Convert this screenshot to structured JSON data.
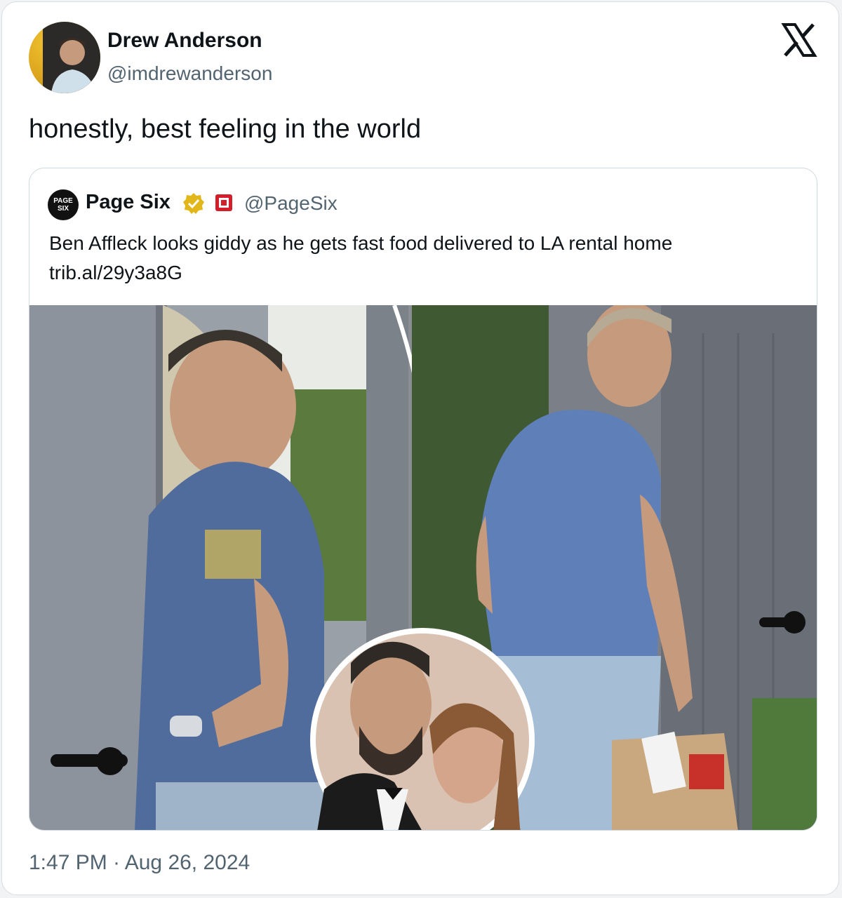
{
  "tweet": {
    "author_name": "Drew Anderson",
    "author_handle": "@imdrewanderson",
    "text": "honestly, best feeling in the world",
    "timestamp": "1:47 PM · Aug 26, 2024"
  },
  "quoted_tweet": {
    "author_name": "Page Six",
    "author_handle": "@PageSix",
    "avatar_text": "PAGE SIX",
    "text": "Ben Affleck looks giddy as he gets fast food delivered to LA rental home",
    "link": "trib.al/29y3a8G"
  },
  "icons": {
    "close": "x-logo-icon",
    "verified": "gold-verified-badge-icon",
    "affiliate": "page-six-affiliate-icon"
  },
  "colors": {
    "text_primary": "#0f1419",
    "text_secondary": "#536471",
    "verified_gold": "#e2b719"
  }
}
